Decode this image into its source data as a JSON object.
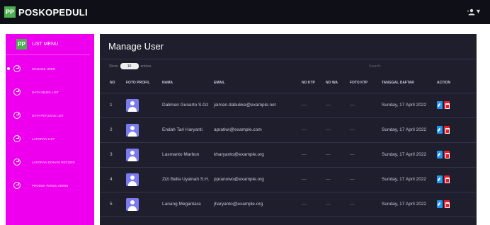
{
  "app": {
    "logo_text": "PP",
    "brand": "POSKOPEDULI",
    "user_menu_caret": "▾"
  },
  "sidebar": {
    "badge": "PP",
    "title": "LIST MENU",
    "items": [
      {
        "label": "MANAGE USER",
        "active": true
      },
      {
        "label": "DATA OBJEK LIST"
      },
      {
        "label": "DATA PETUGAS LIST"
      },
      {
        "label": "LAPORAN LIST"
      },
      {
        "label": "LAPORAN DONASI RECORD"
      },
      {
        "label": "PRODUK PANDU ADMIN"
      }
    ]
  },
  "main": {
    "title": "Manage User",
    "show_label": "Show",
    "entries_value": "10",
    "entries_label": "entries",
    "search_label": "Search:"
  },
  "table": {
    "headers": {
      "no": "NO",
      "foto": "FOTO PROFIL",
      "nama": "NAMA",
      "email": "EMAIL",
      "ktp": "NO KTP",
      "wa": "NO WA",
      "fktp": "FOTO KTP",
      "tgl": "TANGGAL DAFTAR",
      "act": "ACTION"
    },
    "rows": [
      {
        "no": "1",
        "nama": "Daliman Gunarto S.Gz",
        "email": "jaiman.dabukke@example.net",
        "ktp": "—",
        "wa": "—",
        "fktp": "—",
        "tgl": "Sunday, 17 April 2022"
      },
      {
        "no": "2",
        "nama": "Endah Tari Haryanti",
        "email": "apratiwi@example.com",
        "ktp": "—",
        "wa": "—",
        "fktp": "—",
        "tgl": "Sunday, 17 April 2022"
      },
      {
        "no": "3",
        "nama": "Lasmanto Marbun",
        "email": "kharyanto@example.org",
        "ktp": "—",
        "wa": "—",
        "fktp": "—",
        "tgl": "Sunday, 17 April 2022"
      },
      {
        "no": "4",
        "nama": "Zizi Bella Uyainah S.H.",
        "email": "ppranowo@example.org",
        "ktp": "—",
        "wa": "—",
        "fktp": "—",
        "tgl": "Sunday, 17 April 2022"
      },
      {
        "no": "5",
        "nama": "Lanang Megantara",
        "email": "jharyanto@example.org",
        "ktp": "—",
        "wa": "—",
        "fktp": "—",
        "tgl": "Sunday, 17 April 2022"
      }
    ]
  },
  "colors": {
    "sidebar": "#ee00ee",
    "content": "#1e1e2d",
    "topbar": "#0f0f18",
    "badge": "#4caf50",
    "edit": "#2196f3",
    "delete": "#f01c2a"
  }
}
